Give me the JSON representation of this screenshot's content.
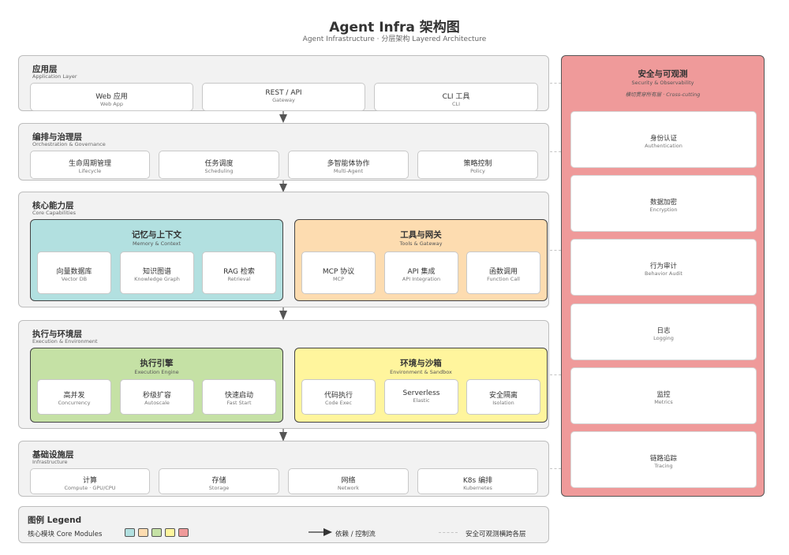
{
  "header": {
    "title": "Agent Infra 架构图",
    "subtitle": "Agent Infrastructure · 分层架构 Layered Architecture"
  },
  "layers": {
    "application": {
      "title": "应用层",
      "subtitle": "Application Layer",
      "items": [
        {
          "label": "Web 应用",
          "sub": "Web App"
        },
        {
          "label": "REST / API",
          "sub": "Gateway"
        },
        {
          "label": "CLI 工具",
          "sub": "CLI"
        }
      ]
    },
    "orchestration": {
      "title": "编排与治理层",
      "subtitle": "Orchestration & Governance",
      "items": [
        {
          "label": "生命周期管理",
          "sub": "Lifecycle"
        },
        {
          "label": "任务调度",
          "sub": "Scheduling"
        },
        {
          "label": "多智能体协作",
          "sub": "Multi-Agent"
        },
        {
          "label": "策略控制",
          "sub": "Policy"
        }
      ]
    },
    "core": {
      "title": "核心能力层",
      "subtitle": "Core Capabilities",
      "modules": [
        {
          "title": "记忆与上下文",
          "subtitle": "Memory & Context",
          "color": "#b2e0e0",
          "items": [
            {
              "label": "向量数据库",
              "sub": "Vector DB"
            },
            {
              "label": "知识图谱",
              "sub": "Knowledge Graph"
            },
            {
              "label": "RAG 检索",
              "sub": "Retrieval"
            }
          ]
        },
        {
          "title": "工具与网关",
          "subtitle": "Tools & Gateway",
          "color": "#fddcb0",
          "items": [
            {
              "label": "MCP 协议",
              "sub": "MCP"
            },
            {
              "label": "API 集成",
              "sub": "API Integration"
            },
            {
              "label": "函数调用",
              "sub": "Function Call"
            }
          ]
        }
      ]
    },
    "execution": {
      "title": "执行与环境层",
      "subtitle": "Execution & Environment",
      "modules": [
        {
          "title": "执行引擎",
          "subtitle": "Execution Engine",
          "color": "#c5e1a5",
          "items": [
            {
              "label": "高并发",
              "sub": "Concurrency"
            },
            {
              "label": "秒级扩容",
              "sub": "Autoscale"
            },
            {
              "label": "快速启动",
              "sub": "Fast Start"
            }
          ]
        },
        {
          "title": "环境与沙箱",
          "subtitle": "Environment & Sandbox",
          "color": "#fff59d",
          "items": [
            {
              "label": "代码执行",
              "sub": "Code Exec"
            },
            {
              "label": "Serverless",
              "sub": "Elastic"
            },
            {
              "label": "安全隔离",
              "sub": "Isolation"
            }
          ]
        }
      ]
    },
    "infrastructure": {
      "title": "基础设施层",
      "subtitle": "Infrastructure",
      "items": [
        {
          "label": "计算",
          "sub": "Compute · GPU/CPU"
        },
        {
          "label": "存储",
          "sub": "Storage"
        },
        {
          "label": "网络",
          "sub": "Network"
        },
        {
          "label": "K8s 编排",
          "sub": "Kubernetes"
        }
      ]
    }
  },
  "security": {
    "title": "安全与可观测",
    "subtitle": "Security & Observability",
    "note": "横切贯穿所有层 · Cross-cutting",
    "color": "#ef9a9a",
    "items": [
      {
        "label": "身份认证",
        "sub": "Authentication"
      },
      {
        "label": "数据加密",
        "sub": "Encryption"
      },
      {
        "label": "行为审计",
        "sub": "Behavior Audit"
      },
      {
        "label": "日志",
        "sub": "Logging"
      },
      {
        "label": "监控",
        "sub": "Metrics"
      },
      {
        "label": "链路追踪",
        "sub": "Tracing"
      }
    ]
  },
  "legend": {
    "title": "图例 Legend",
    "core_modules": "核心模块 Core Modules",
    "swatches": [
      "#b2e0e0",
      "#fddcb0",
      "#c5e1a5",
      "#fff59d",
      "#ef9a9a"
    ],
    "dependency": "依赖 / 控制流",
    "cross_cutting": "安全可观测横跨各层"
  }
}
